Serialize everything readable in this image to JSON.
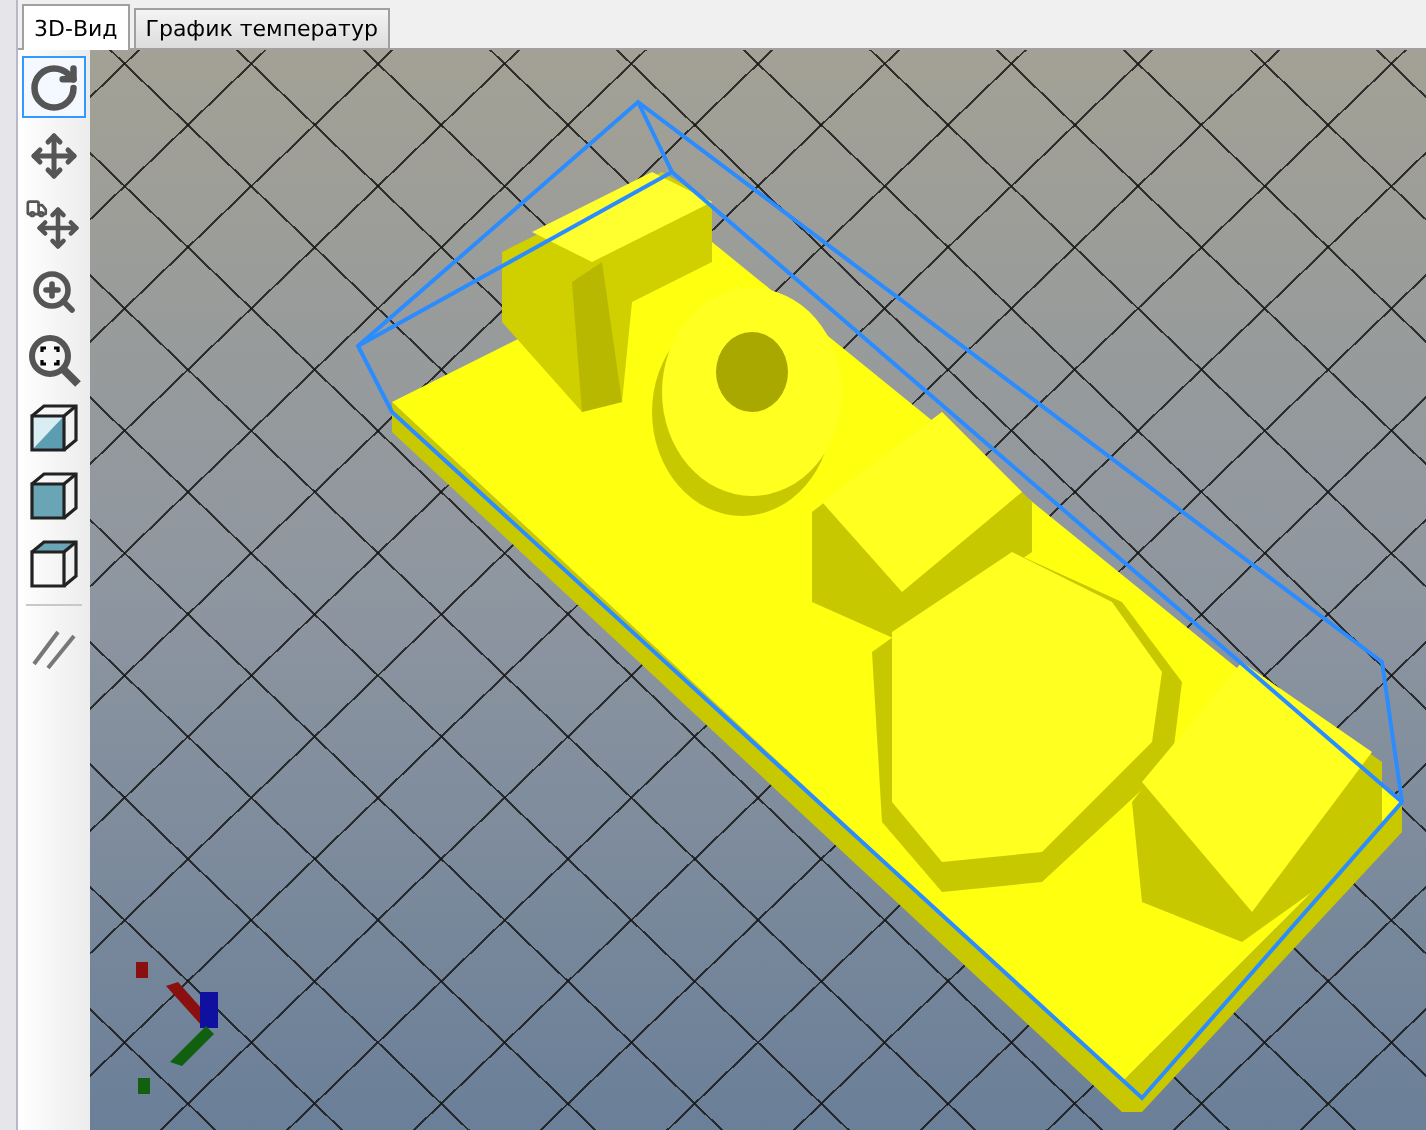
{
  "tabs": [
    {
      "label": "3D-Вид",
      "selected": true
    },
    {
      "label": "График температур",
      "selected": false
    }
  ],
  "toolbar": [
    {
      "kind": "rotate",
      "selected": true
    },
    {
      "kind": "move",
      "selected": false
    },
    {
      "kind": "move-object",
      "selected": false
    },
    {
      "kind": "zoom",
      "selected": false
    },
    {
      "kind": "fit",
      "selected": false
    },
    {
      "kind": "cube-diagonal",
      "selected": false
    },
    {
      "kind": "cube-front",
      "selected": false
    },
    {
      "kind": "cube-top",
      "selected": false
    },
    {
      "kind": "separator"
    },
    {
      "kind": "parallel",
      "selected": false
    }
  ]
}
